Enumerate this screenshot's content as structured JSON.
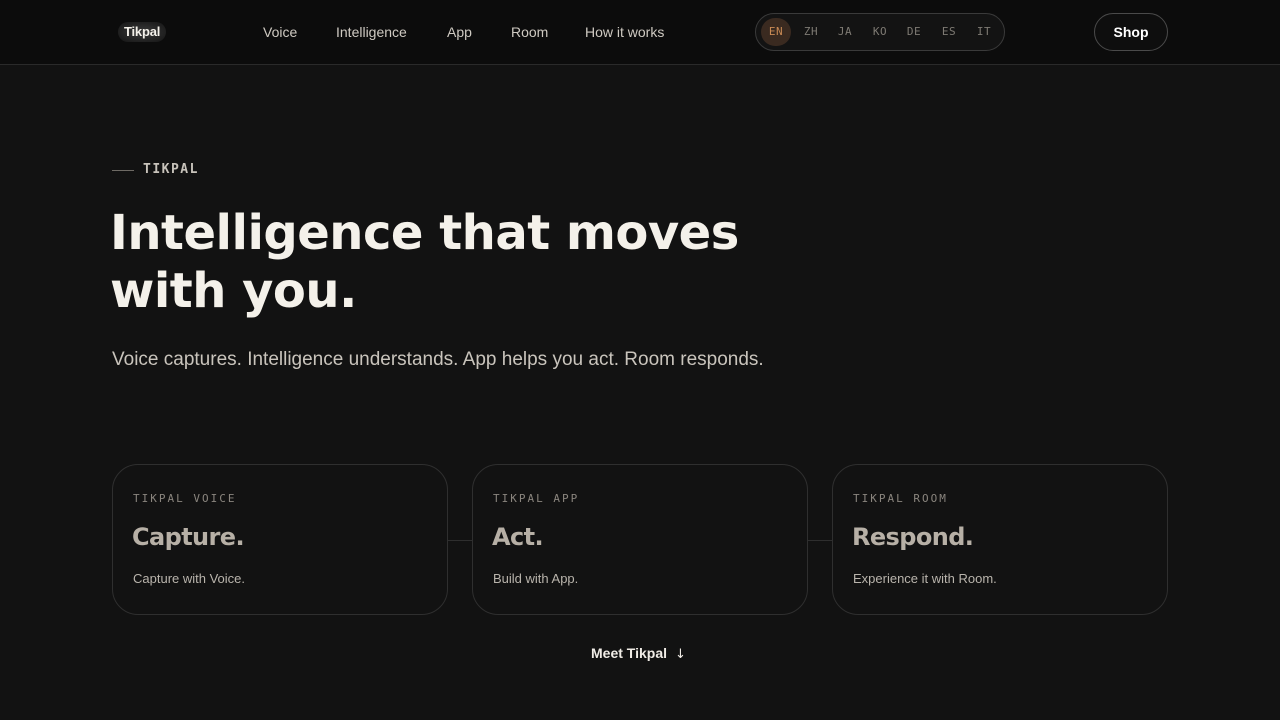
{
  "header": {
    "logo": "Tikpal",
    "nav": [
      "Voice",
      "Intelligence",
      "App",
      "Room",
      "How it works"
    ],
    "languages": [
      "EN",
      "ZH",
      "JA",
      "KO",
      "DE",
      "ES",
      "IT"
    ],
    "active_language": "EN",
    "shop_label": "Shop"
  },
  "hero": {
    "eyebrow": "TIKPAL",
    "headline": "Intelligence that moves with you.",
    "subline": "Voice captures. Intelligence understands. App helps you act. Room responds."
  },
  "cards": [
    {
      "eyebrow": "TIKPAL VOICE",
      "title": "Capture.",
      "desc": "Capture with Voice."
    },
    {
      "eyebrow": "TIKPAL APP",
      "title": "Act.",
      "desc": "Build with App."
    },
    {
      "eyebrow": "TIKPAL ROOM",
      "title": "Respond.",
      "desc": "Experience it with Room."
    }
  ],
  "cta": {
    "label": "Meet Tikpal",
    "icon": "arrow-down-icon"
  },
  "colors": {
    "background": "#121212",
    "accent": "#c98a54",
    "text": "#f4f1ea"
  }
}
